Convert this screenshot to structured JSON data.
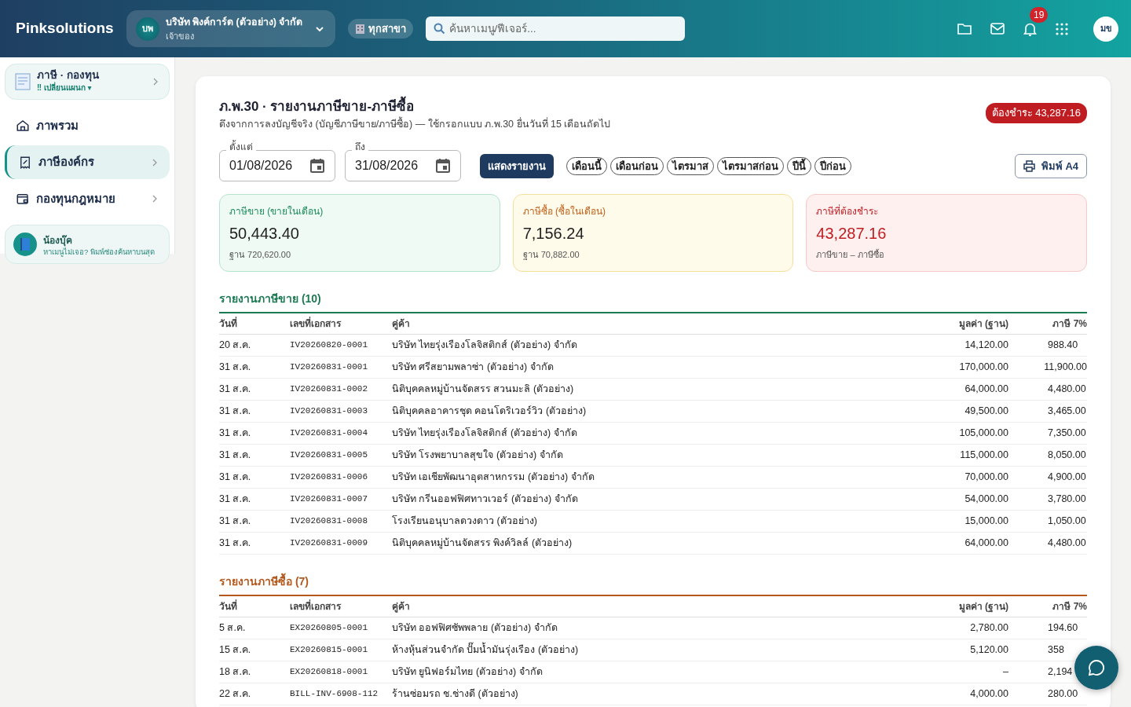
{
  "brand": "Pinksolutions",
  "company": {
    "initials": "บพ",
    "name": "บริษัท พิงค์การ์ด (ตัวอย่าง) จำกัด",
    "role": "เจ้าของ"
  },
  "branch": "ทุกสาขา",
  "search": {
    "placeholder": "ค้นหาเมนู/ฟีเจอร์..."
  },
  "notifications": "19",
  "user_initials": "มข",
  "sidebar": {
    "module": {
      "title": "ภาษี · กองทุน",
      "subtitle": "‼ เปลี่ยนแผนก ▾"
    },
    "items": [
      {
        "label": "ภาพรวม",
        "selected": false,
        "has_submenu": false
      },
      {
        "label": "ภาษีองค์กร",
        "selected": true,
        "has_submenu": true
      },
      {
        "label": "กองทุนกฎหมาย",
        "selected": false,
        "has_submenu": true
      }
    ],
    "helper": {
      "name": "น้องบุ๊ค",
      "text": "หาเมนูไม่เจอ? พิมพ์ช่องค้นหาบนสุด"
    }
  },
  "report": {
    "title": "ภ.พ.30 · รายงานภาษีขาย-ภาษีซื้อ",
    "subtitle": "ดึงจากการลงบัญชีจริง (บัญชีภาษีขาย/ภาษีซื้อ) — ใช้กรอกแบบ ภ.พ.30 ยื่นวันที่ 15 เดือนถัดไป",
    "due_badge": "ต้องชำระ 43,287.16",
    "from": {
      "label": "ตั้งแต่",
      "value": "01/08/2026"
    },
    "to": {
      "label": "ถึง",
      "value": "31/08/2026"
    },
    "show_button": "แสดงรายงาน",
    "ranges": [
      "เดือนนี้",
      "เดือนก่อน",
      "ไตรมาส",
      "ไตรมาสก่อน",
      "ปีนี้",
      "ปีก่อน"
    ],
    "print_button": "พิมพ์ A4",
    "summary": [
      {
        "label": "ภาษีขาย (ขายในเดือน)",
        "value": "50,443.40",
        "note": "ฐาน 720,620.00"
      },
      {
        "label": "ภาษีซื้อ (ซื้อในเดือน)",
        "value": "7,156.24",
        "note": "ฐาน 70,882.00"
      },
      {
        "label": "ภาษีที่ต้องชำระ",
        "value": "43,287.16",
        "note": "ภาษีขาย – ภาษีซื้อ"
      }
    ],
    "tables": [
      {
        "title": "รายงานภาษีขาย (10)",
        "columns": [
          "วันที่",
          "เลขที่เอกสาร",
          "คู่ค้า",
          "มูลค่า (ฐาน)",
          "ภาษี 7%"
        ],
        "rows": [
          [
            "20 ส.ค.",
            "IV20260820-0001",
            "บริษัท ไทยรุ่งเรืองโลจิสติกส์ (ตัวอย่าง) จำกัด",
            "14,120.00",
            "988.40"
          ],
          [
            "31 ส.ค.",
            "IV20260831-0001",
            "บริษัท ศรีสยามพลาซ่า (ตัวอย่าง) จำกัด",
            "170,000.00",
            "11,900.00"
          ],
          [
            "31 ส.ค.",
            "IV20260831-0002",
            "นิติบุคคลหมู่บ้านจัดสรร สวนมะลิ (ตัวอย่าง)",
            "64,000.00",
            "4,480.00"
          ],
          [
            "31 ส.ค.",
            "IV20260831-0003",
            "นิติบุคคลอาคารชุด คอนโดริเวอร์วิว (ตัวอย่าง)",
            "49,500.00",
            "3,465.00"
          ],
          [
            "31 ส.ค.",
            "IV20260831-0004",
            "บริษัท ไทยรุ่งเรืองโลจิสติกส์ (ตัวอย่าง) จำกัด",
            "105,000.00",
            "7,350.00"
          ],
          [
            "31 ส.ค.",
            "IV20260831-0005",
            "บริษัท โรงพยาบาลสุขใจ (ตัวอย่าง) จำกัด",
            "115,000.00",
            "8,050.00"
          ],
          [
            "31 ส.ค.",
            "IV20260831-0006",
            "บริษัท เอเชียพัฒนาอุตสาหกรรม (ตัวอย่าง) จำกัด",
            "70,000.00",
            "4,900.00"
          ],
          [
            "31 ส.ค.",
            "IV20260831-0007",
            "บริษัท กรีนออฟฟิศทาวเวอร์ (ตัวอย่าง) จำกัด",
            "54,000.00",
            "3,780.00"
          ],
          [
            "31 ส.ค.",
            "IV20260831-0008",
            "โรงเรียนอนุบาลดวงดาว (ตัวอย่าง)",
            "15,000.00",
            "1,050.00"
          ],
          [
            "31 ส.ค.",
            "IV20260831-0009",
            "นิติบุคคลหมู่บ้านจัดสรร พิงค์วิลล์ (ตัวอย่าง)",
            "64,000.00",
            "4,480.00"
          ]
        ]
      },
      {
        "title": "รายงานภาษีซื้อ (7)",
        "columns": [
          "วันที่",
          "เลขที่เอกสาร",
          "คู่ค้า",
          "มูลค่า (ฐาน)",
          "ภาษี 7%"
        ],
        "rows": [
          [
            "5 ส.ค.",
            "EX20260805-0001",
            "บริษัท ออฟฟิศซัพพลาย (ตัวอย่าง) จำกัด",
            "2,780.00",
            "194.60"
          ],
          [
            "15 ส.ค.",
            "EX20260815-0001",
            "ห้างหุ้นส่วนจำกัด ปั๊มน้ำมันรุ่งเรือง (ตัวอย่าง)",
            "5,120.00",
            "358"
          ],
          [
            "18 ส.ค.",
            "EX20260818-0001",
            "บริษัท ยูนิฟอร์มไทย (ตัวอย่าง) จำกัด",
            "–",
            "2,194"
          ],
          [
            "22 ส.ค.",
            "BILL-INV-6908-112",
            "ร้านซ่อมรถ ช.ช่างดี (ตัวอย่าง)",
            "4,000.00",
            "280.00"
          ]
        ]
      }
    ]
  }
}
